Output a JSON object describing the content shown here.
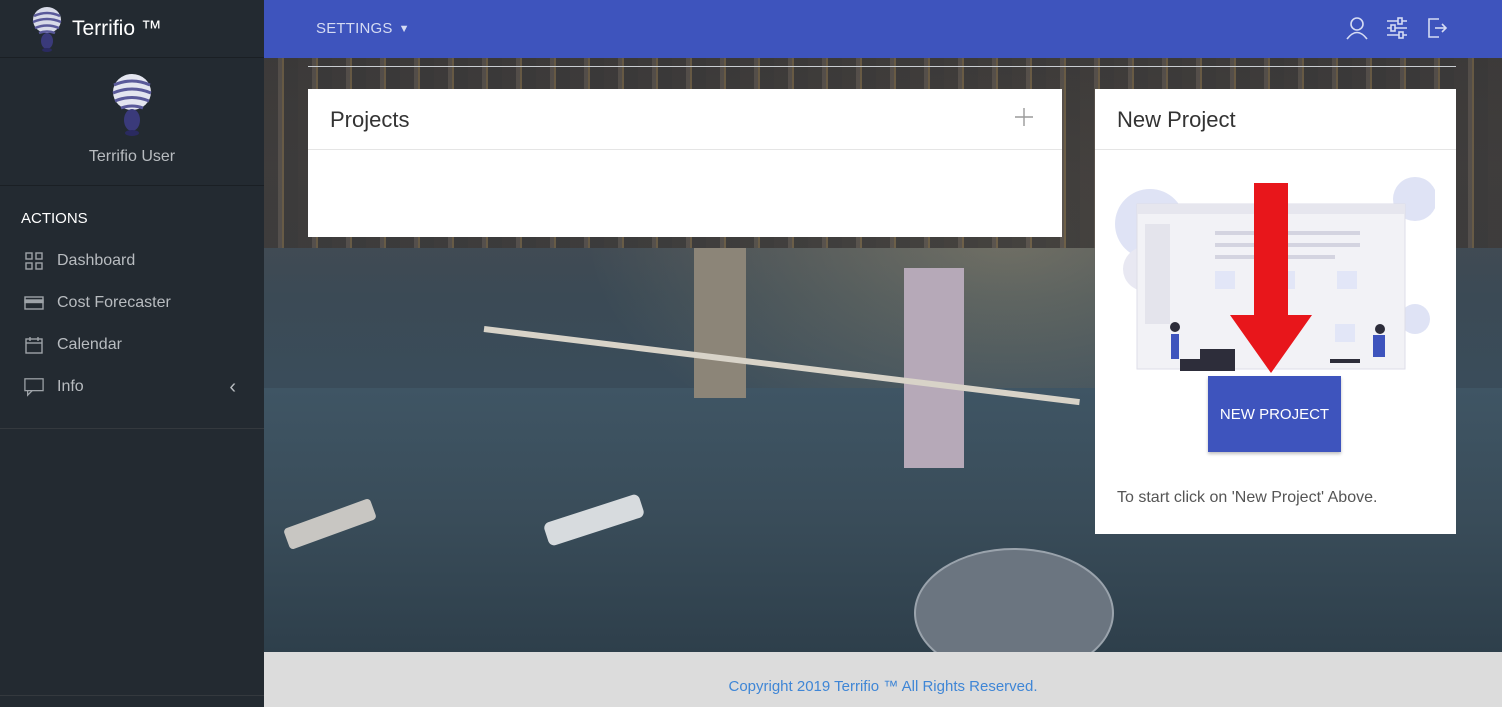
{
  "brand": {
    "name": "Terrifio ™"
  },
  "user": {
    "name": "Terrifio User"
  },
  "sidebar": {
    "section_title": "ACTIONS",
    "items": [
      {
        "label": "Dashboard",
        "icon": "grid-icon"
      },
      {
        "label": "Cost Forecaster",
        "icon": "card-icon"
      },
      {
        "label": "Calendar",
        "icon": "calendar-icon"
      },
      {
        "label": "Info",
        "icon": "chat-icon",
        "has_chevron": true
      }
    ]
  },
  "topbar": {
    "settings_label": "SETTINGS",
    "icons": [
      "user-icon",
      "sliders-icon",
      "logout-icon"
    ]
  },
  "projects_card": {
    "title": "Projects"
  },
  "new_project_card": {
    "title": "New Project",
    "button_label": "NEW PROJECT",
    "hint": "To start click on 'New Project' Above."
  },
  "footer": {
    "copyright": "Copyright 2019 Terrifio ™ All Rights Reserved."
  },
  "colors": {
    "topbar": "#3e54bd",
    "sidebar": "#232a31",
    "button": "#3e54bd",
    "footer_text": "#3f86d6",
    "arrow": "#e8161b"
  }
}
